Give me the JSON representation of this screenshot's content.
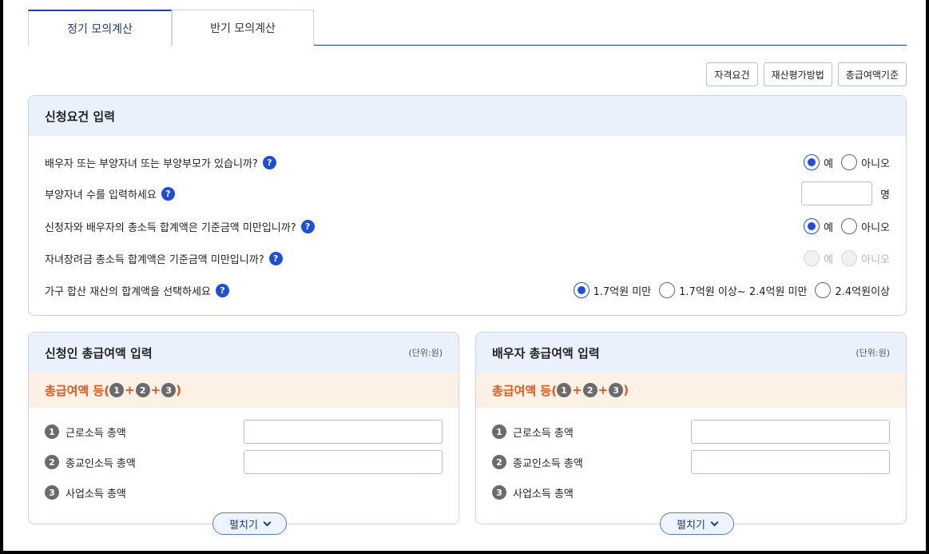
{
  "tabs": [
    {
      "label": "정기 모의계산",
      "active": true
    },
    {
      "label": "반기 모의계산",
      "active": false
    }
  ],
  "top_buttons": [
    "자격요건",
    "재산평가방법",
    "총급여액기준"
  ],
  "requirements": {
    "title": "신청요건 입력",
    "questions": [
      {
        "text": "배우자 또는 부양자녀 또는 부양부모가 있습니까?",
        "yes": "예",
        "no": "아니오",
        "selected": "yes",
        "disabled": false
      },
      {
        "text": "부양자녀 수를 입력하세요",
        "input_value": "",
        "unit": "명"
      },
      {
        "text": "신청자와 배우자의 총소득 합계액은 기준금액 미만입니까?",
        "yes": "예",
        "no": "아니오",
        "selected": "yes",
        "disabled": false
      },
      {
        "text": "자녀장려금 총소득 합계액은 기준금액 미만입니까?",
        "yes": "예",
        "no": "아니오",
        "selected": null,
        "disabled": true
      },
      {
        "text": "가구 합산 재산의 합계액을 선택하세요",
        "options": [
          "1.7억원 미만",
          "1.7억원 이상~ 2.4억원 미만",
          "2.4억원이상"
        ],
        "selected": 0
      }
    ]
  },
  "applicant": {
    "title": "신청인 총급여액 입력",
    "unit": "(단위:원)",
    "total_label_prefix": "총급여액 등(",
    "total_label_suffix": ")",
    "plus": "+",
    "rows": [
      {
        "num": "1",
        "label": "근로소득 총액",
        "value": ""
      },
      {
        "num": "2",
        "label": "종교인소득 총액",
        "value": ""
      },
      {
        "num": "3",
        "label": "사업소득 총액"
      }
    ],
    "expand_label": "펼치기"
  },
  "spouse": {
    "title": "배우자 총급여액 입력",
    "unit": "(단위:원)",
    "total_label_prefix": "총급여액 등(",
    "total_label_suffix": ")",
    "plus": "+",
    "rows": [
      {
        "num": "1",
        "label": "근로소득 총액",
        "value": ""
      },
      {
        "num": "2",
        "label": "종교인소득 총액",
        "value": ""
      },
      {
        "num": "3",
        "label": "사업소득 총액"
      }
    ],
    "expand_label": "펼치기"
  },
  "help_glyph": "?",
  "colors": {
    "accent": "#1d4ed8",
    "total_text": "#e2581c",
    "panel_header": "#eaf1fd",
    "total_bg": "#fdf0e4"
  }
}
